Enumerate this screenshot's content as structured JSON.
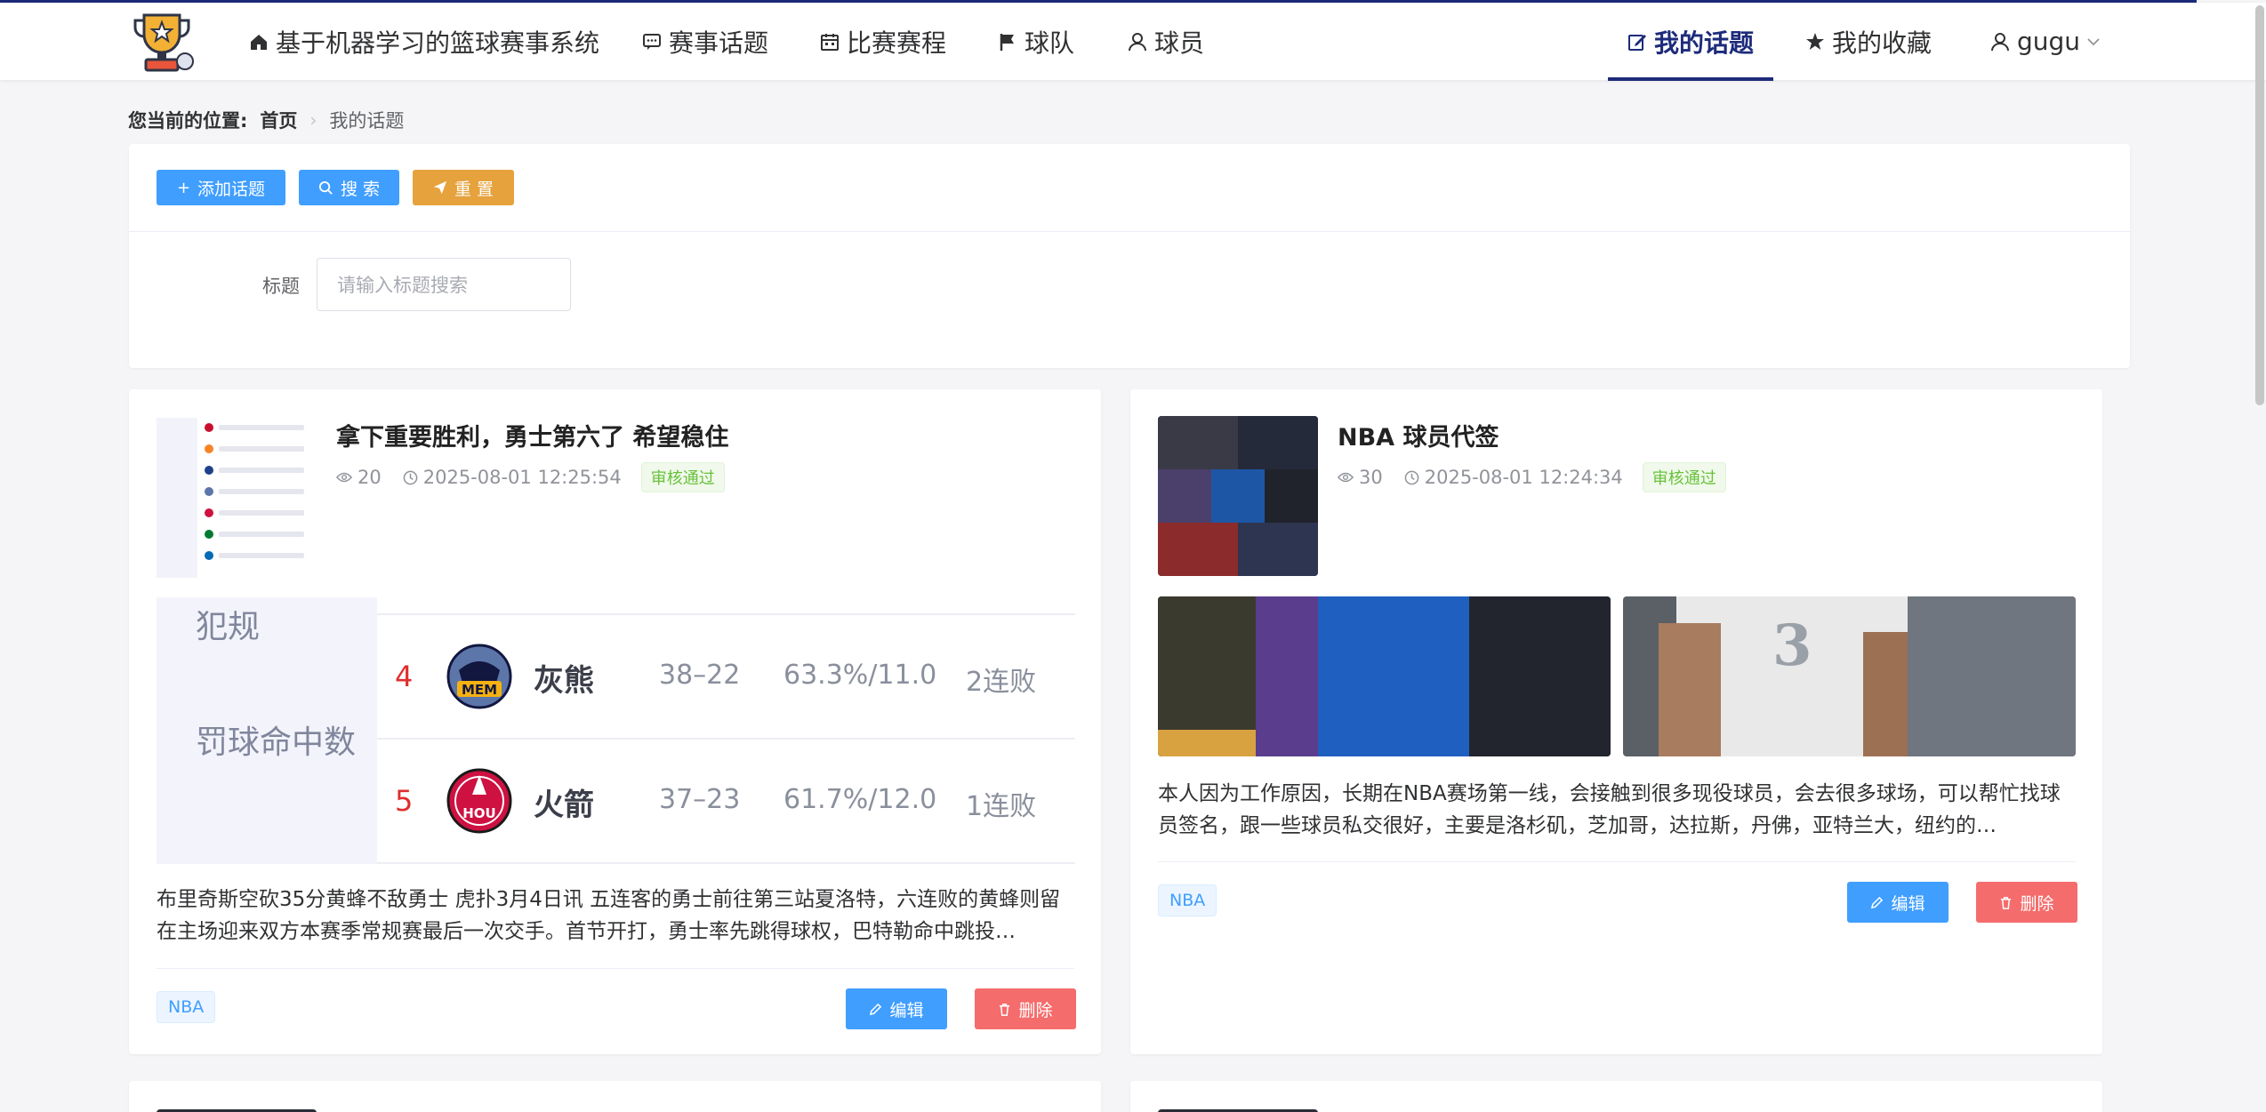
{
  "nav": {
    "brand": "基于机器学习的篮球赛事系统",
    "topics": "赛事话题",
    "schedule": "比赛赛程",
    "teams": "球队",
    "players": "球员",
    "my_topics": "我的话题",
    "favorites": "我的收藏",
    "user": "gugu"
  },
  "breadcrumb": {
    "label": "您当前的位置:",
    "home": "首页",
    "current": "我的话题"
  },
  "toolbar": {
    "add": "添加话题",
    "search": "搜 索",
    "reset": "重 置"
  },
  "filter": {
    "title_label": "标题",
    "title_placeholder": "请输入标题搜索"
  },
  "cards": [
    {
      "title": "拿下重要胜利，勇士第六了 希望稳住",
      "views": "20",
      "date": "2025-08-01 12:25:54",
      "status": "审核通过",
      "desc": "布里奇斯空砍35分黄蜂不敌勇士 虎扑3月4日讯 五连客的勇士前往第三站夏洛特，六连败的黄蜂则留在主场迎来双方本赛季常规赛最后一次交手。首节开打，勇士率先跳得球权，巴特勒命中跳投…",
      "tag": "NBA",
      "edit": "编辑",
      "delete": "删除",
      "preview": {
        "side_1": "犯规",
        "side_2": "罚球命中数",
        "rows": [
          {
            "rank": "4",
            "logo": "MEM",
            "team": "灰熊",
            "record": "38–22",
            "pct": "63.3%/11.0",
            "streak": "2连败"
          },
          {
            "rank": "5",
            "logo": "HOU",
            "team": "火箭",
            "record": "37–23",
            "pct": "61.7%/12.0",
            "streak": "1连败"
          }
        ]
      }
    },
    {
      "title": "NBA 球员代签",
      "views": "30",
      "date": "2025-08-01 12:24:34",
      "status": "审核通过",
      "desc": "本人因为工作原因，长期在NBA赛场第一线，会接触到很多现役球员，会去很多球场，可以帮忙找球员签名，跟一些球员私交很好，主要是洛杉矶，芝加哥，达拉斯，丹佛，亚特兰大，纽约的…",
      "tag": "NBA",
      "edit": "编辑",
      "delete": "删除",
      "jersey_number": "3"
    }
  ],
  "colors": {
    "primary": "#409eff",
    "warning": "#e6a23c",
    "danger": "#f56c6c",
    "nav_active": "#1d2b7a",
    "success": "#67c23a"
  }
}
